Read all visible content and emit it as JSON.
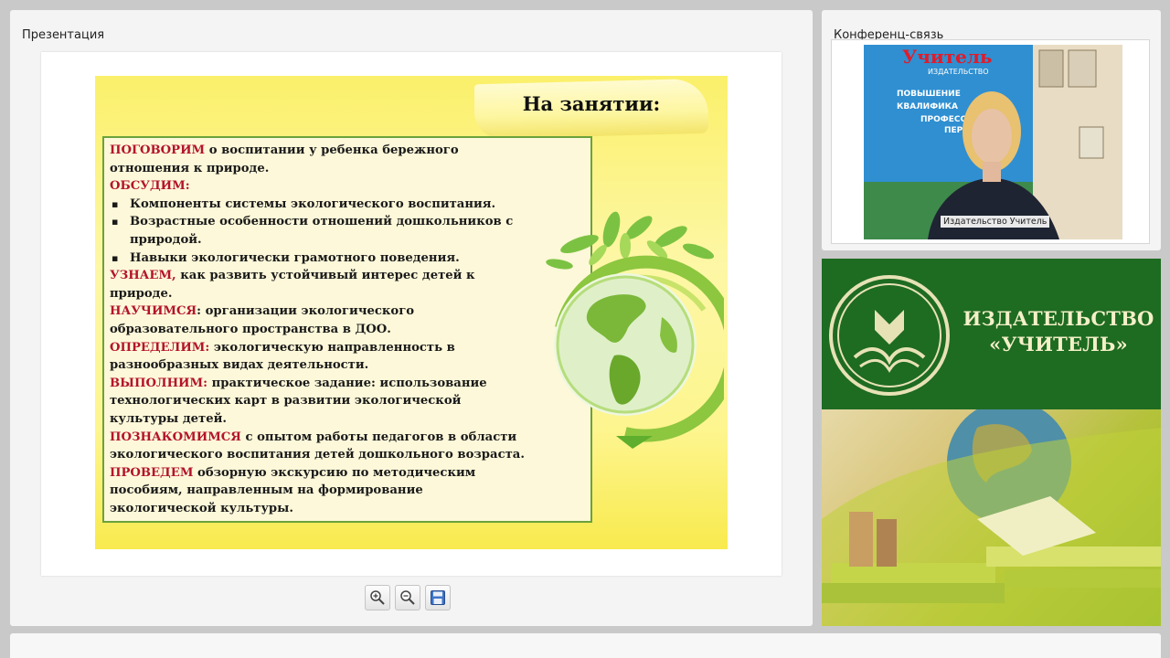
{
  "presentation": {
    "title": "Презентация",
    "slide": {
      "heading": "На занятии:",
      "lines": [
        {
          "kw": "ПОГОВОРИМ",
          "text": "  о воспитании у  ребенка бережного"
        },
        {
          "kw": "",
          "text": "отношения  к природе."
        },
        {
          "kw": "ОБСУДИМ:",
          "text": ""
        },
        {
          "bullet": "Компоненты системы экологического воспитания."
        },
        {
          "bullet": "Возрастные особенности отношений дошкольников с"
        },
        {
          "indent": "природой."
        },
        {
          "bullet": "Навыки экологически грамотного поведения."
        },
        {
          "kw": "УЗНАЕМ,",
          "text": " как развить устойчивый интерес детей к"
        },
        {
          "kw": "",
          "text": "природе."
        },
        {
          "kw": "НАУЧИМСЯ",
          "text": ": организации экологического"
        },
        {
          "kw": "",
          "text": "образовательного пространства в ДОО."
        },
        {
          "kw": "ОПРЕДЕЛИМ:",
          "text": " экологическую  направленность в"
        },
        {
          "kw": "",
          "text": "разнообразных  видах деятельности."
        },
        {
          "kw": "ВЫПОЛНИМ:",
          "text": " практическое задание: использование"
        },
        {
          "kw": "",
          "text": "технологических карт в развитии экологической"
        },
        {
          "kw": "",
          "text": "культуры детей."
        },
        {
          "kw": "ПОЗНАКОМИМСЯ",
          "text": " с опытом работы педагогов в области"
        },
        {
          "kw": "",
          "text": "экологического воспитания детей дошкольного возраста."
        },
        {
          "kw": "ПРОВЕДЕМ",
          "text": " обзорную экскурсию  по методическим"
        },
        {
          "kw": "",
          "text": "пособиям, направленным на формирование"
        },
        {
          "kw": "",
          "text": "экологической культуры."
        }
      ]
    },
    "controls": {
      "zoom_in": "zoom-in-icon",
      "zoom_out": "zoom-out-icon",
      "save": "save-icon"
    }
  },
  "conference": {
    "title": "Конференц-связь",
    "video_label": "Издательство Учитель",
    "backdrop": {
      "brand": "Учитель",
      "sub": "ИЗДАТЕЛЬСТВО",
      "items": [
        "ПОВЫШЕНИЕ",
        "КВАЛИФИКА",
        "ПРОФЕССИ",
        "ПЕРЕП"
      ]
    }
  },
  "ad": {
    "line1": "ИЗДАТЕЛЬСТВО",
    "line2": "«УЧИТЕЛЬ»"
  },
  "colors": {
    "keyword": "#b3132b",
    "slide_border": "#6aa23c",
    "ad_green": "#1e6b22"
  }
}
